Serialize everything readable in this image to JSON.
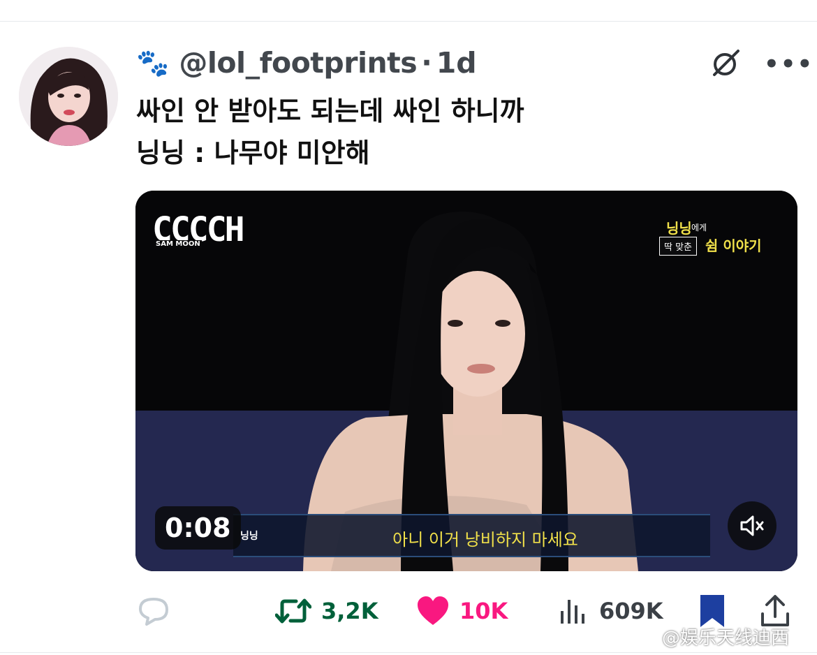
{
  "tweet": {
    "handle": "@lol_footprints",
    "separator": "·",
    "age": "1d",
    "name_emoji": "🐾",
    "text_line1": "싸인 안 받아도 되는데 싸인 하니까",
    "text_line2": "닝닝 : 나무야 미안해"
  },
  "video": {
    "channel_logo": "CCCCH",
    "channel_logo_sub": "SAM MOON",
    "corner_caption_top": "닝닝",
    "corner_caption_top_small": "에게",
    "corner_caption_box": "딱 맞춘",
    "corner_caption_bottom": "쉼 이야기",
    "speaker": "닝닝",
    "subtitle": "아니 이거 낭비하지 마세요",
    "timestamp": "0:08",
    "muted": true
  },
  "actions": {
    "retweets": "3,2K",
    "likes": "10K",
    "views": "609K",
    "bookmarked": true
  },
  "watermark": "@娱乐天线迪西",
  "colors": {
    "retweet": "#00603a",
    "like": "#f91880",
    "bookmark": "#1d3fa0",
    "text": "#0f1419",
    "muted_icon": "#536471"
  },
  "icons": {
    "more": "more-horizontal-icon",
    "grok": "grok-icon",
    "reply": "reply-icon",
    "retweet": "retweet-icon",
    "like": "heart-icon",
    "views": "views-icon",
    "bookmark": "bookmark-icon",
    "share": "share-icon",
    "mute": "volume-muted-icon"
  }
}
